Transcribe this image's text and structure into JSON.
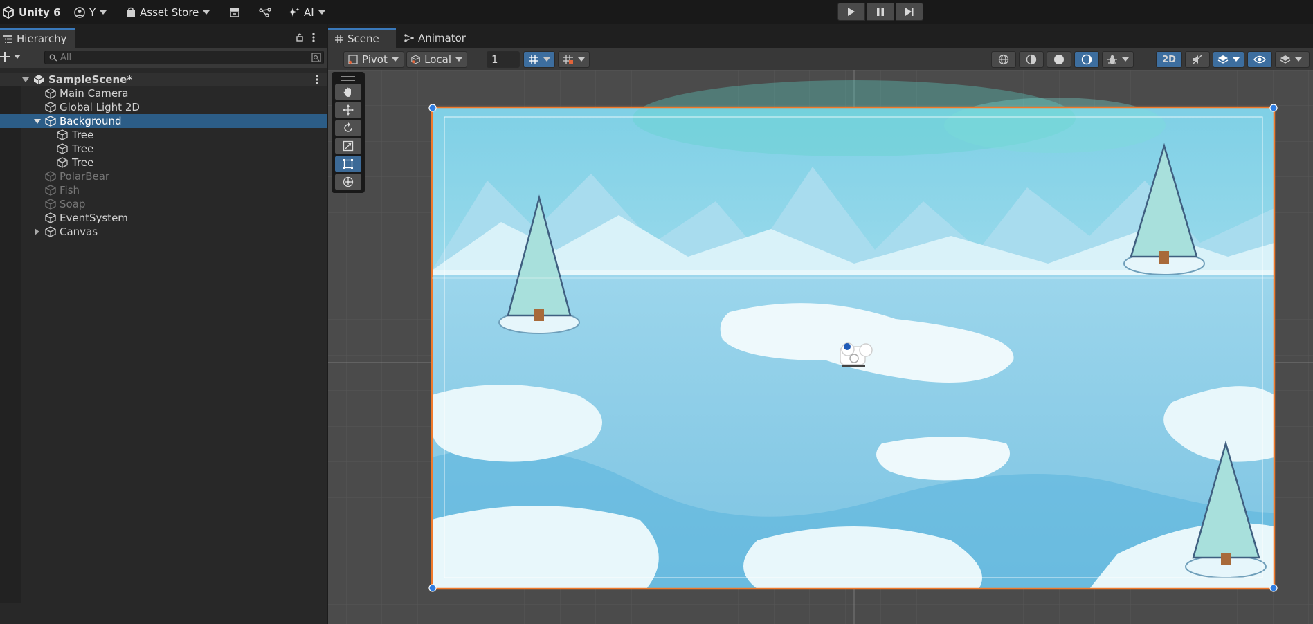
{
  "topbar": {
    "app_label": "Unity 6",
    "account_label": "Y",
    "asset_store_label": "Asset Store",
    "ai_label": "AI",
    "icons": [
      "unity-logo-icon",
      "account-icon",
      "bag-icon",
      "package-box-icon",
      "version-control-icon",
      "sparkle-icon",
      "play-icon",
      "pause-icon",
      "step-icon"
    ]
  },
  "hierarchy": {
    "tab_label": "Hierarchy",
    "search_placeholder": "All",
    "scene_name": "SampleScene*",
    "items": [
      {
        "label": "Main Camera",
        "depth": 1,
        "state": "normal"
      },
      {
        "label": "Global Light 2D",
        "depth": 1,
        "state": "normal"
      },
      {
        "label": "Background",
        "depth": 1,
        "state": "selected",
        "expanded": true
      },
      {
        "label": "Tree",
        "depth": 2,
        "state": "normal"
      },
      {
        "label": "Tree",
        "depth": 2,
        "state": "normal"
      },
      {
        "label": "Tree",
        "depth": 2,
        "state": "normal"
      },
      {
        "label": "PolarBear",
        "depth": 1,
        "state": "inactive"
      },
      {
        "label": "Fish",
        "depth": 1,
        "state": "inactive"
      },
      {
        "label": "Soap",
        "depth": 1,
        "state": "inactive"
      },
      {
        "label": "EventSystem",
        "depth": 1,
        "state": "normal"
      },
      {
        "label": "Canvas",
        "depth": 1,
        "state": "normal",
        "collapsed": true
      }
    ]
  },
  "scene_view": {
    "tabs": [
      {
        "label": "Scene",
        "active": true
      },
      {
        "label": "Animator",
        "active": false
      }
    ],
    "pivot_label": "Pivot",
    "local_label": "Local",
    "grid_snap_value": "1",
    "mode_2d_label": "2D"
  },
  "colors": {
    "selection": "#2c5d87",
    "accent_blue": "#3d6e9f",
    "selection_outline": "#f07a2c",
    "handle_blue": "#2f7de1"
  }
}
